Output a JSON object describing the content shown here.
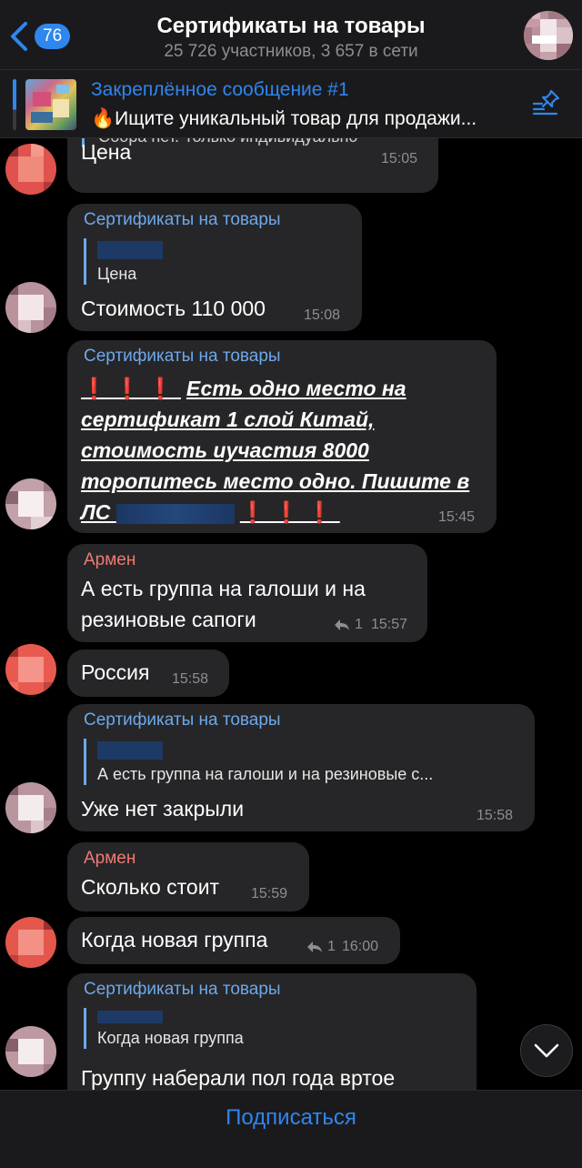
{
  "header": {
    "back_count": "76",
    "title": "Сертификаты на товары",
    "subtitle": "25 726 участников, 3 657 в сети"
  },
  "pinned": {
    "title": "Закреплённое сообщение #1",
    "text": "🔥Ищите уникальный товар для продажи..."
  },
  "messages": {
    "m0": {
      "text": "Цена",
      "time": "15:05",
      "partial": "Сбора нет. Только индивидуально"
    },
    "m1": {
      "sender": "Сертификаты на товары",
      "reply_text": "Цена",
      "text": "Стоимость 110 000",
      "time": "15:08"
    },
    "m2": {
      "sender": "Сертификаты на товары",
      "excl": "❗❗❗",
      "line1": "Есть одно место на",
      "line2": "сертификат 1 слой Китай,",
      "line3": "стоимость иучастия 8000",
      "line4": "торопитесь место одно. Пишите в",
      "line5": "ЛС",
      "time": "15:45"
    },
    "m3": {
      "sender": "Армен",
      "line1": "А есть группа на галоши и на",
      "line2": "резиновые сапоги",
      "replies": "1",
      "time": "15:57"
    },
    "m4": {
      "text": "Россия",
      "time": "15:58"
    },
    "m5": {
      "sender": "Сертификаты на товары",
      "reply_text": "А есть группа на галоши и на резиновые с...",
      "text": "Уже нет закрыли",
      "time": "15:58"
    },
    "m6": {
      "sender": "Армен",
      "text": "Сколько стоит",
      "time": "15:59"
    },
    "m7": {
      "text": "Когда новая группа",
      "replies": "1",
      "time": "16:00"
    },
    "m8": {
      "sender": "Сертификаты на товары",
      "reply_text": "Когда новая группа",
      "text": "Группу наберали пол года вртое"
    }
  },
  "footer": {
    "subscribe": "Подписаться"
  },
  "icons": {
    "back": "chevron-left-icon",
    "pin": "pin-list-icon",
    "reply": "reply-arrow-icon",
    "scroll": "chevron-down-icon"
  },
  "colors": {
    "accent": "#2f86ee",
    "channel_name": "#6ea8ea",
    "armen_name": "#ef7a73",
    "bubble": "#262628"
  }
}
